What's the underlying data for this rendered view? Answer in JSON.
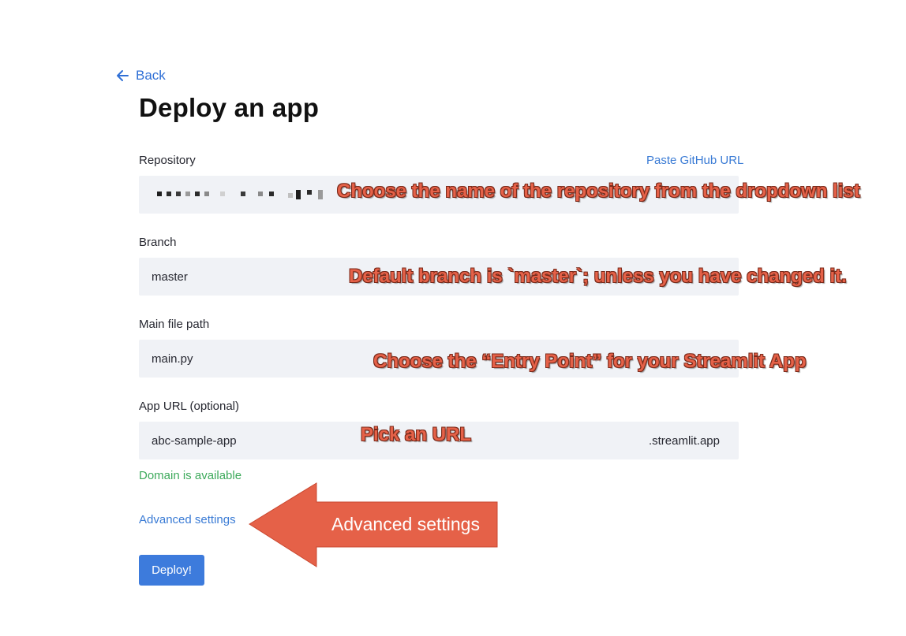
{
  "back": {
    "label": "Back"
  },
  "page": {
    "title": "Deploy an app"
  },
  "repository": {
    "label": "Repository",
    "paste_link": "Paste GitHub URL"
  },
  "branch": {
    "label": "Branch",
    "value": "master"
  },
  "main_file": {
    "label": "Main file path",
    "value": "main.py"
  },
  "app_url": {
    "label": "App URL (optional)",
    "value": "abc-sample-app",
    "suffix": ".streamlit.app",
    "status": "Domain is available"
  },
  "advanced": {
    "label": "Advanced settings"
  },
  "deploy": {
    "label": "Deploy!"
  },
  "annotations": {
    "repository": "Choose the name of the repository from the dropdown list",
    "branch": "Default branch is `master`; unless you have changed it.",
    "main_file": "Choose the “Entry Point” for your Streamlit App",
    "url": "Pick an URL",
    "advanced": "Advanced settings"
  },
  "colors": {
    "link": "#3a7bd5",
    "button": "#3d7bdc",
    "field_bg": "#f0f2f6",
    "success": "#3daa5b",
    "annotation": "#e56148"
  }
}
